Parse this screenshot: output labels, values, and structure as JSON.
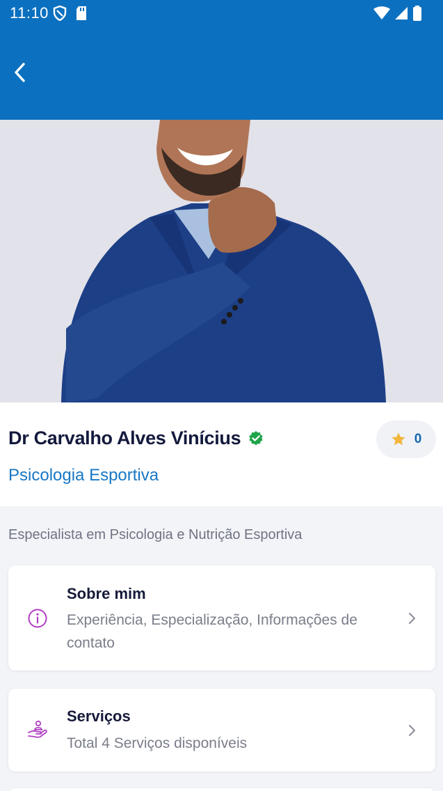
{
  "status_bar": {
    "time": "11:10",
    "left_icons": [
      "shield-icon",
      "sd-card-icon"
    ],
    "right_icons": [
      "wifi-icon",
      "signal-icon",
      "battery-icon"
    ]
  },
  "app_bar": {
    "back_icon": "chevron-left-icon",
    "background": "#0b70bf"
  },
  "profile": {
    "photo": "doctor-portrait",
    "name": "Dr Carvalho Alves Vinícius",
    "verified_icon": "verified-badge-icon",
    "specialty": "Psicologia Esportiva",
    "rating": "0",
    "rating_icon": "star-icon"
  },
  "description": "Especialista em Psicologia e Nutrição Esportiva",
  "menu": [
    {
      "icon": "info-icon",
      "title": "Sobre mim",
      "subtitle": "Experiência, Especialização, Informações de contato"
    },
    {
      "icon": "hand-service-icon",
      "title": "Serviços",
      "subtitle": "Total 4 Serviços disponíveis"
    }
  ],
  "colors": {
    "primary": "#0b70bf",
    "accent_icon": "#b13fc3",
    "verified": "#1fa34a",
    "star": "#f2b63c"
  }
}
